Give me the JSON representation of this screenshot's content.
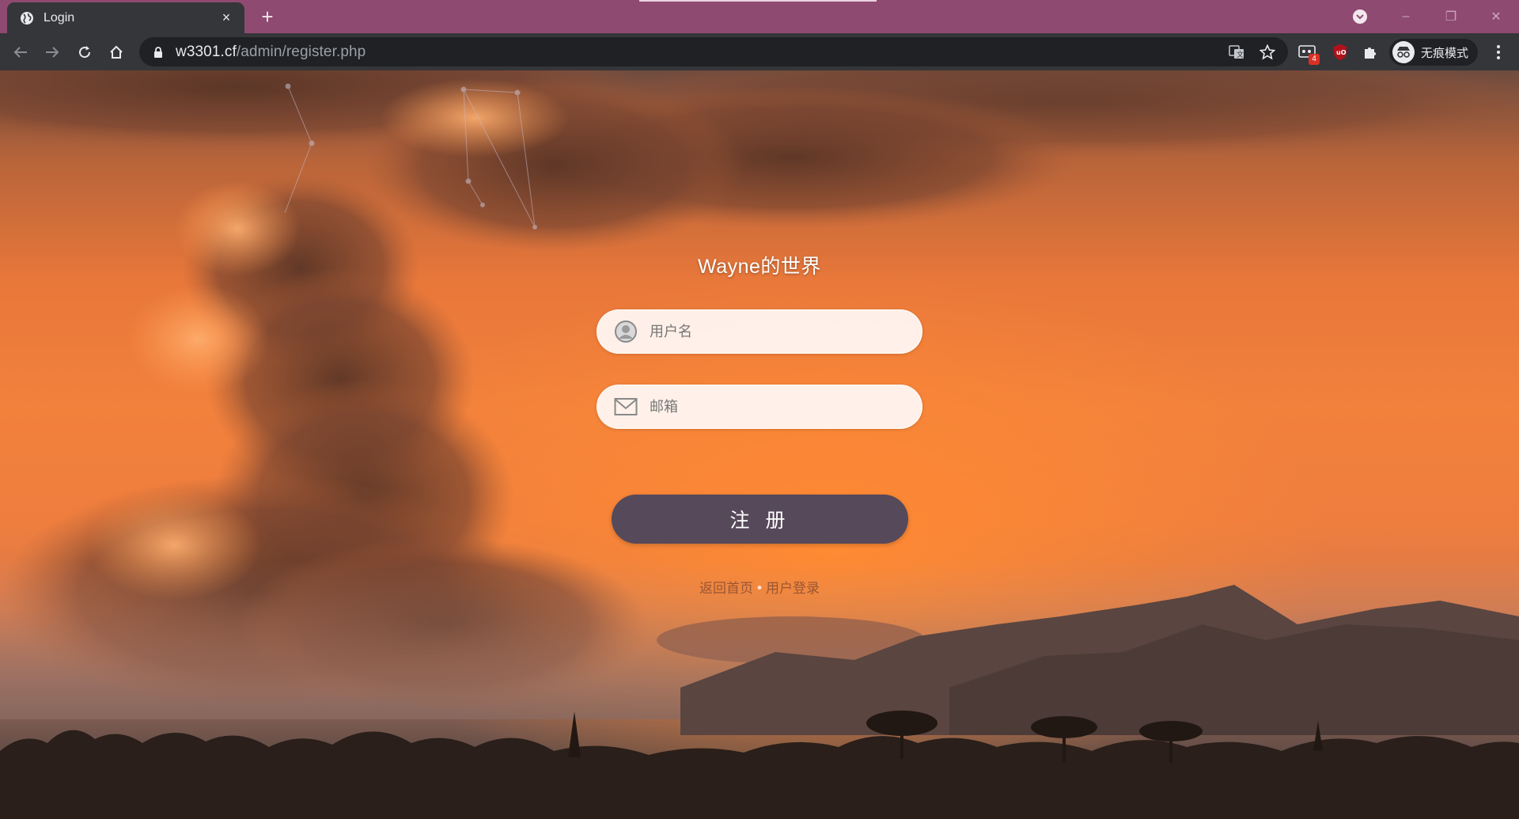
{
  "browser": {
    "tab": {
      "title": "Login",
      "favicon": "globe-icon",
      "close": "×"
    },
    "new_tab": "+",
    "window_controls": {
      "minimize": "–",
      "restore": "❐",
      "close": "✕"
    },
    "address": {
      "host": "w3301.cf",
      "path": "/admin/register.php"
    },
    "extensions": {
      "badge_count": "4"
    },
    "profile": {
      "label": "无痕模式"
    },
    "colors": {
      "tabbar": "#8f4a72",
      "toolbar": "#35363a",
      "omnibox": "#202124"
    }
  },
  "page": {
    "title": "Wayne的世界",
    "username": {
      "placeholder": "用户名",
      "icon": "user-avatar-icon"
    },
    "email": {
      "placeholder": "邮箱",
      "icon": "mail-icon"
    },
    "submit_label": "注 册",
    "links": {
      "home": "返回首页",
      "separator": "•",
      "login": "用户登录"
    },
    "colors": {
      "button": "#56495a",
      "link": "#9a5633",
      "sky": "#f2813c"
    }
  }
}
